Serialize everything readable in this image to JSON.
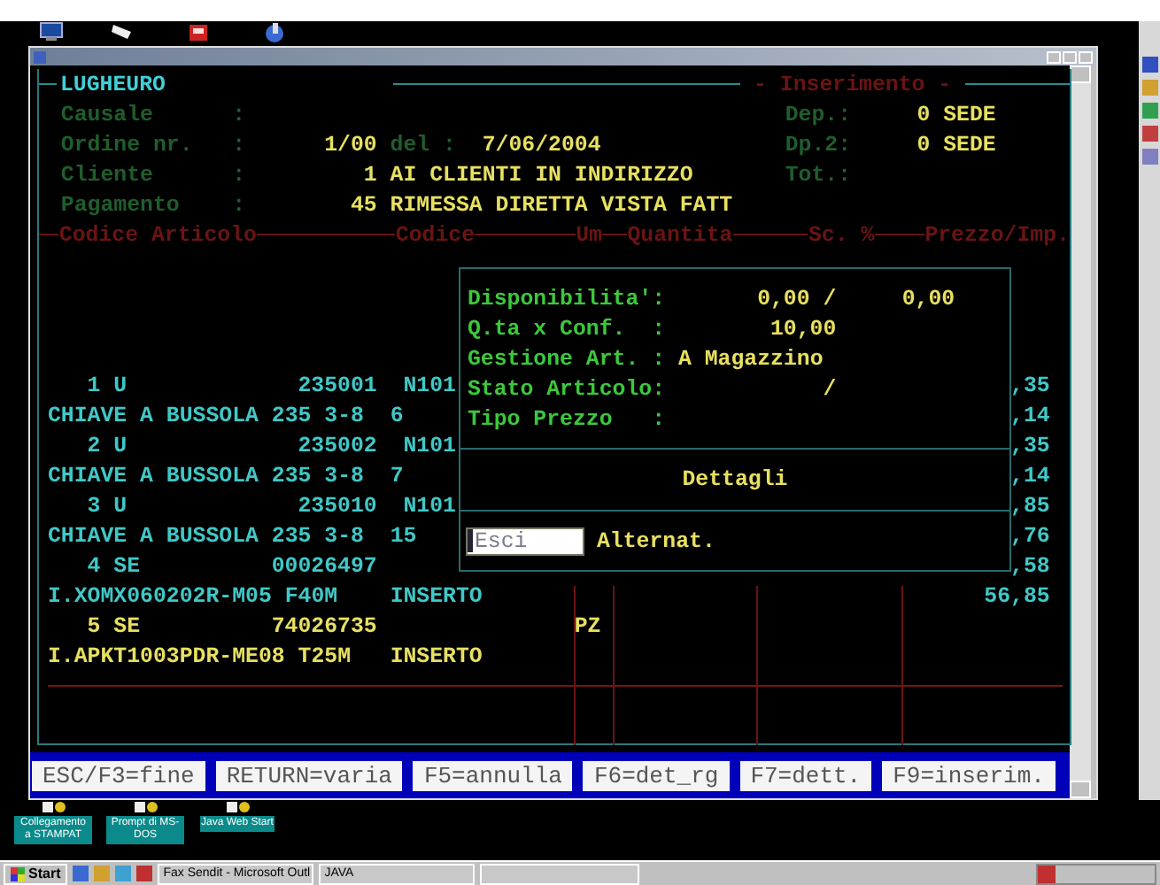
{
  "window": {
    "header": {
      "title": "LUGHEURO",
      "mode": "- Inserimento -"
    },
    "fields": [
      {
        "label": "Causale      :"
      },
      {
        "label": "Ordine nr.   :",
        "parts": [
          {
            "kind": "value",
            "text": "1/00"
          },
          {
            "kind": "label",
            "text": "del :"
          },
          {
            "kind": "value",
            "text": "7/06/2004"
          }
        ]
      },
      {
        "label": "Cliente      :",
        "parts": [
          {
            "kind": "value",
            "text": "1"
          },
          {
            "kind": "value",
            "text": "AI CLIENTI IN INDIRIZZO"
          }
        ]
      },
      {
        "label": "Pagamento    :",
        "parts": [
          {
            "kind": "value",
            "text": "45"
          },
          {
            "kind": "value",
            "text": "RIMESSA DIRETTA VISTA FATT"
          }
        ]
      }
    ],
    "totals": [
      {
        "label": "Dep.:",
        "value": "0 SEDE"
      },
      {
        "label": "Dp.2:",
        "value": "0 SEDE"
      },
      {
        "label": "Tot.:"
      }
    ],
    "columns": [
      "Codice Articolo",
      "Codice",
      "Um",
      "Quantita",
      "Sc. %",
      "Prezzo/Imp."
    ],
    "rows": [
      {
        "selected": false,
        "number": "1 U",
        "code": "235001",
        "sub_code": "N101",
        "price": ",35",
        "description": "CHIAVE A BUSSOLA 235 3-8",
        "detail": "6",
        "amount": ",14"
      },
      {
        "selected": false,
        "number": "2 U",
        "code": "235002",
        "sub_code": "N101",
        "price": ",35",
        "description": "CHIAVE A BUSSOLA 235 3-8",
        "detail": "7",
        "amount": ",14"
      },
      {
        "selected": false,
        "number": "3 U",
        "code": "235010",
        "sub_code": "N101",
        "price": ",85",
        "description": "CHIAVE A BUSSOLA 235 3-8",
        "detail": "15",
        "amount": ",76"
      },
      {
        "selected": false,
        "number": "4 SE",
        "code": "00026497",
        "price": ",58",
        "description": "I.XOMX060202R-M05 F40M",
        "detail": "INSERTO",
        "amount": "56,85"
      },
      {
        "selected": true,
        "number": "5 SE",
        "code": "74026735",
        "um": "PZ",
        "description": "I.APKT1003PDR-ME08 T25M",
        "detail": "INSERTO"
      }
    ],
    "details_popup": {
      "lines": [
        {
          "label": "Disponibilita':",
          "value": "0,00 /",
          "value_2": "0,00"
        },
        {
          "label": "Q.ta x Conf.  :",
          "value": "10,00"
        },
        {
          "label": "Gestione Art. :",
          "value": "A Magazzino"
        },
        {
          "label": "Stato Articolo:",
          "value": "/"
        },
        {
          "label": "Tipo Prezzo   :"
        }
      ],
      "title": "Dettagli",
      "input": {
        "value": "Esci"
      },
      "button": "Alternat."
    },
    "function_keys": [
      "ESC/F3=fine",
      "RETURN=varia",
      "F5=annulla",
      "F6=det_rg",
      "F7=dett.",
      "F9=inserim."
    ]
  },
  "desktop_icons": [
    {
      "label": "Collegamento a STAMPAT"
    },
    {
      "label": "Prompt di MS-DOS"
    },
    {
      "label": "Java Web Start"
    }
  ],
  "taskbar": {
    "start": "Start",
    "tasks": [
      {
        "label": "Fax Sendit - Microsoft Outl"
      },
      {
        "label": "JAVA"
      }
    ]
  }
}
